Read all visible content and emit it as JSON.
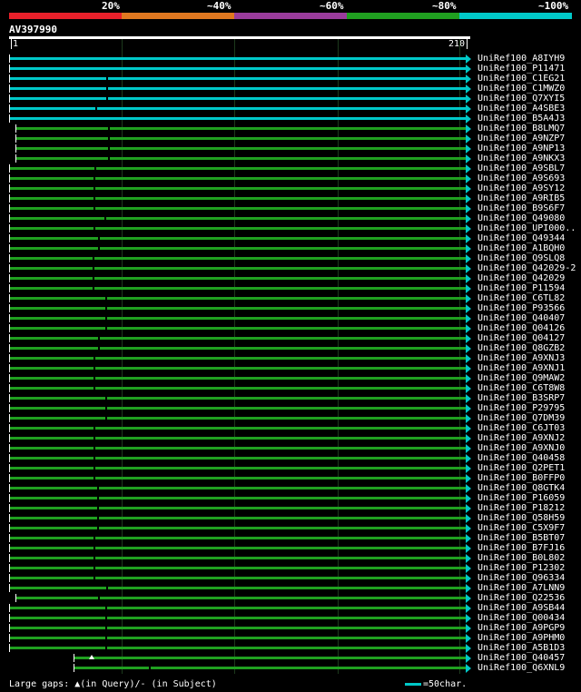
{
  "legend": [
    {
      "label": "20%",
      "color": "#e8202a"
    },
    {
      "label": "~40%",
      "color": "#e07820"
    },
    {
      "label": "~60%",
      "color": "#9a3c9c"
    },
    {
      "label": "~80%",
      "color": "#20a020"
    },
    {
      "label": "~100%",
      "color": "#00c8c8"
    }
  ],
  "query": {
    "name": "AV397990",
    "start": "1",
    "end": "210"
  },
  "hits": [
    {
      "name": "UniRef100_A8IYH9",
      "color": "#00c8c8"
    },
    {
      "name": "UniRef100_P11471",
      "color": "#00c8c8"
    },
    {
      "name": "UniRef100_C1EG21",
      "color": "#00c8c8"
    },
    {
      "name": "UniRef100_C1MWZ0",
      "color": "#00c8c8"
    },
    {
      "name": "UniRef100_Q7XYI5",
      "color": "#00c8c8"
    },
    {
      "name": "UniRef100_A4SBE3",
      "color": "#00c8c8"
    },
    {
      "name": "UniRef100_B5A4J3",
      "color": "#00c8c8"
    },
    {
      "name": "UniRef100_B8LMQ7",
      "color": "#20a020"
    },
    {
      "name": "UniRef100_A9NZP7",
      "color": "#20a020"
    },
    {
      "name": "UniRef100_A9NP13",
      "color": "#20a020"
    },
    {
      "name": "UniRef100_A9NKX3",
      "color": "#20a020"
    },
    {
      "name": "UniRef100_A9SBL7",
      "color": "#20a020"
    },
    {
      "name": "UniRef100_A9S693",
      "color": "#20a020"
    },
    {
      "name": "UniRef100_A9SY12",
      "color": "#20a020"
    },
    {
      "name": "UniRef100_A9RIB5",
      "color": "#20a020"
    },
    {
      "name": "UniRef100_B9S6F7",
      "color": "#20a020"
    },
    {
      "name": "UniRef100_Q49080",
      "color": "#20a020"
    },
    {
      "name": "UniRef100_UPI000..",
      "color": "#20a020"
    },
    {
      "name": "UniRef100_Q49344",
      "color": "#20a020"
    },
    {
      "name": "UniRef100_A1BQH0",
      "color": "#20a020"
    },
    {
      "name": "UniRef100_Q9SLQ8",
      "color": "#20a020"
    },
    {
      "name": "UniRef100_Q42029-2",
      "color": "#20a020"
    },
    {
      "name": "UniRef100_Q42029",
      "color": "#20a020"
    },
    {
      "name": "UniRef100_P11594",
      "color": "#20a020"
    },
    {
      "name": "UniRef100_C6TL82",
      "color": "#20a020"
    },
    {
      "name": "UniRef100_P93566",
      "color": "#20a020"
    },
    {
      "name": "UniRef100_Q40407",
      "color": "#20a020"
    },
    {
      "name": "UniRef100_Q04126",
      "color": "#20a020"
    },
    {
      "name": "UniRef100_Q04127",
      "color": "#20a020"
    },
    {
      "name": "UniRef100_Q8GZB2",
      "color": "#20a020"
    },
    {
      "name": "UniRef100_A9XNJ3",
      "color": "#20a020"
    },
    {
      "name": "UniRef100_A9XNJ1",
      "color": "#20a020"
    },
    {
      "name": "UniRef100_Q9MAW2",
      "color": "#20a020"
    },
    {
      "name": "UniRef100_C6T8W8",
      "color": "#20a020"
    },
    {
      "name": "UniRef100_B3SRP7",
      "color": "#20a020"
    },
    {
      "name": "UniRef100_P29795",
      "color": "#20a020"
    },
    {
      "name": "UniRef100_Q7DM39",
      "color": "#20a020"
    },
    {
      "name": "UniRef100_C6JT03",
      "color": "#20a020"
    },
    {
      "name": "UniRef100_A9XNJ2",
      "color": "#20a020"
    },
    {
      "name": "UniRef100_A9XNJ0",
      "color": "#20a020"
    },
    {
      "name": "UniRef100_Q40458",
      "color": "#20a020"
    },
    {
      "name": "UniRef100_Q2PET1",
      "color": "#20a020"
    },
    {
      "name": "UniRef100_B0FFP0",
      "color": "#20a020"
    },
    {
      "name": "UniRef100_Q8GTK4",
      "color": "#20a020"
    },
    {
      "name": "UniRef100_P16059",
      "color": "#20a020"
    },
    {
      "name": "UniRef100_P18212",
      "color": "#20a020"
    },
    {
      "name": "UniRef100_Q58H59",
      "color": "#20a020"
    },
    {
      "name": "UniRef100_C5X9F7",
      "color": "#20a020"
    },
    {
      "name": "UniRef100_B5BT07",
      "color": "#20a020"
    },
    {
      "name": "UniRef100_B7FJ16",
      "color": "#20a020"
    },
    {
      "name": "UniRef100_B0L802",
      "color": "#20a020"
    },
    {
      "name": "UniRef100_P12302",
      "color": "#20a020"
    },
    {
      "name": "UniRef100_Q96334",
      "color": "#20a020"
    },
    {
      "name": "UniRef100_A7LNN9",
      "color": "#20a020"
    },
    {
      "name": "UniRef100_Q22536",
      "color": "#20a020"
    },
    {
      "name": "UniRef100_A9SB44",
      "color": "#20a020"
    },
    {
      "name": "UniRef100_Q00434",
      "color": "#20a020"
    },
    {
      "name": "UniRef100_A9PGP9",
      "color": "#20a020"
    },
    {
      "name": "UniRef100_A9PHM0",
      "color": "#20a020"
    },
    {
      "name": "UniRef100_A5B1D3",
      "color": "#20a020"
    },
    {
      "name": "UniRef100_Q40457",
      "color": "#20a020"
    },
    {
      "name": "UniRef100_Q6XNL9",
      "color": "#20a020"
    }
  ],
  "footer": {
    "gaps_text": "Large gaps: ▲(in Query)/- (in Subject)",
    "scale_text": "=50char."
  }
}
